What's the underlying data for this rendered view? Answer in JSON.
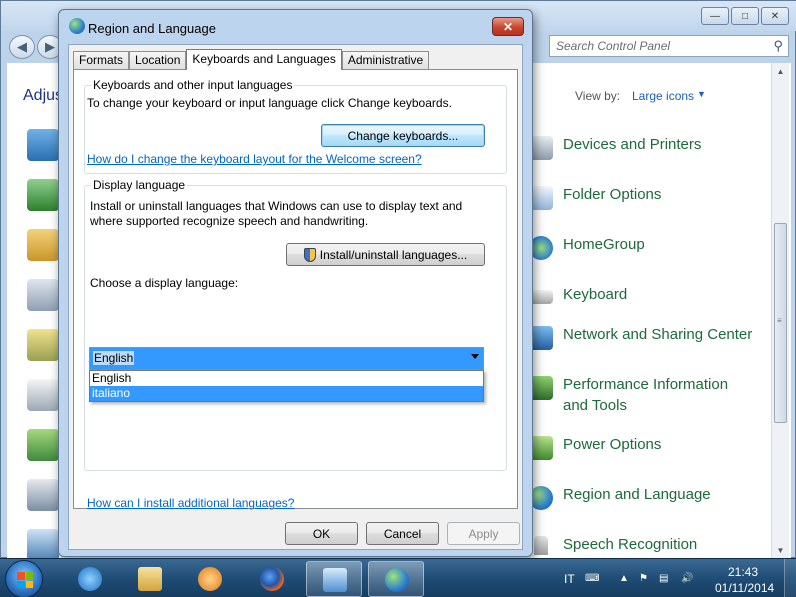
{
  "control_panel": {
    "search_placeholder": "Search Control Panel",
    "heading": "Adjus",
    "view_by_label": "View by:",
    "view_by_value": "Large icons",
    "items": [
      {
        "label": "Devices and Printers"
      },
      {
        "label": "Folder Options"
      },
      {
        "label": "HomeGroup"
      },
      {
        "label": "Keyboard"
      },
      {
        "label": "Network and Sharing Center"
      },
      {
        "label": "Performance Information and Tools"
      },
      {
        "label": "Power Options"
      },
      {
        "label": "Region and Language"
      },
      {
        "label": "Speech Recognition"
      }
    ]
  },
  "dialog": {
    "title": "Region and Language",
    "tabs": [
      {
        "label": "Formats"
      },
      {
        "label": "Location"
      },
      {
        "label": "Keyboards and Languages"
      },
      {
        "label": "Administrative"
      }
    ],
    "active_tab": "Keyboards and Languages",
    "keyboards_group": {
      "label": "Keyboards and other input languages",
      "description": "To change your keyboard or input language click Change keyboards.",
      "change_button": "Change keyboards...",
      "help_link": "How do I change the keyboard layout for the Welcome screen?"
    },
    "display_group": {
      "label": "Display language",
      "description_line1": "Install or uninstall languages that Windows can use to display text and",
      "description_line2": "where supported recognize speech and handwriting.",
      "install_button": "Install/uninstall languages...",
      "choose_label": "Choose a display language:",
      "selected": "English",
      "options": [
        {
          "label": "English"
        },
        {
          "label": "italiano"
        }
      ]
    },
    "additional_link": "How can I install additional languages?",
    "ok_label": "OK",
    "cancel_label": "Cancel",
    "apply_label": "Apply"
  },
  "taskbar": {
    "language": "IT",
    "time": "21:43",
    "date": "01/11/2014"
  }
}
